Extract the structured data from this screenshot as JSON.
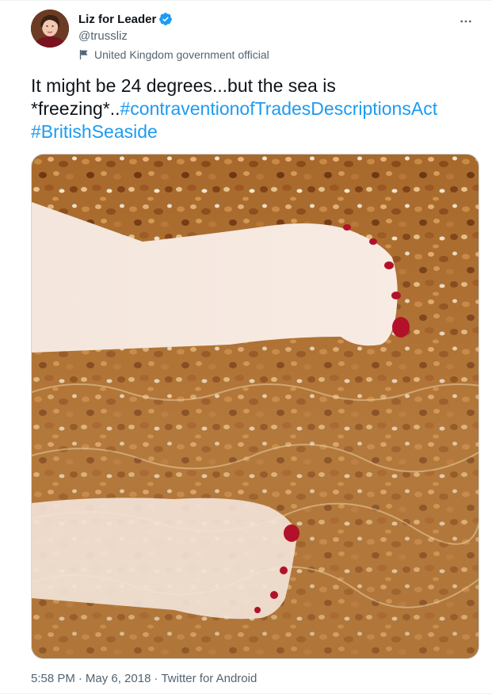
{
  "tweet": {
    "author": {
      "display_name": "Liz for Leader",
      "handle": "@trussliz",
      "verified": true,
      "label": "United Kingdom government official"
    },
    "text_plain": "It might be 24 degrees...but the sea is *freezing*..",
    "hashtags": [
      "#contraventionofTradesDescriptionsAct",
      "#BritishSeaside"
    ],
    "footer": {
      "time": "5:58 PM",
      "separator": "·",
      "date": "May 6, 2018",
      "source": "Twitter for Android"
    }
  },
  "icons": {
    "verified": "verified-badge-icon",
    "label": "flag-icon",
    "more": "more-horizontal-icon"
  },
  "colors": {
    "link": "#1d9bf0",
    "secondary_text": "#536471",
    "verified": "#1d9bf0"
  }
}
